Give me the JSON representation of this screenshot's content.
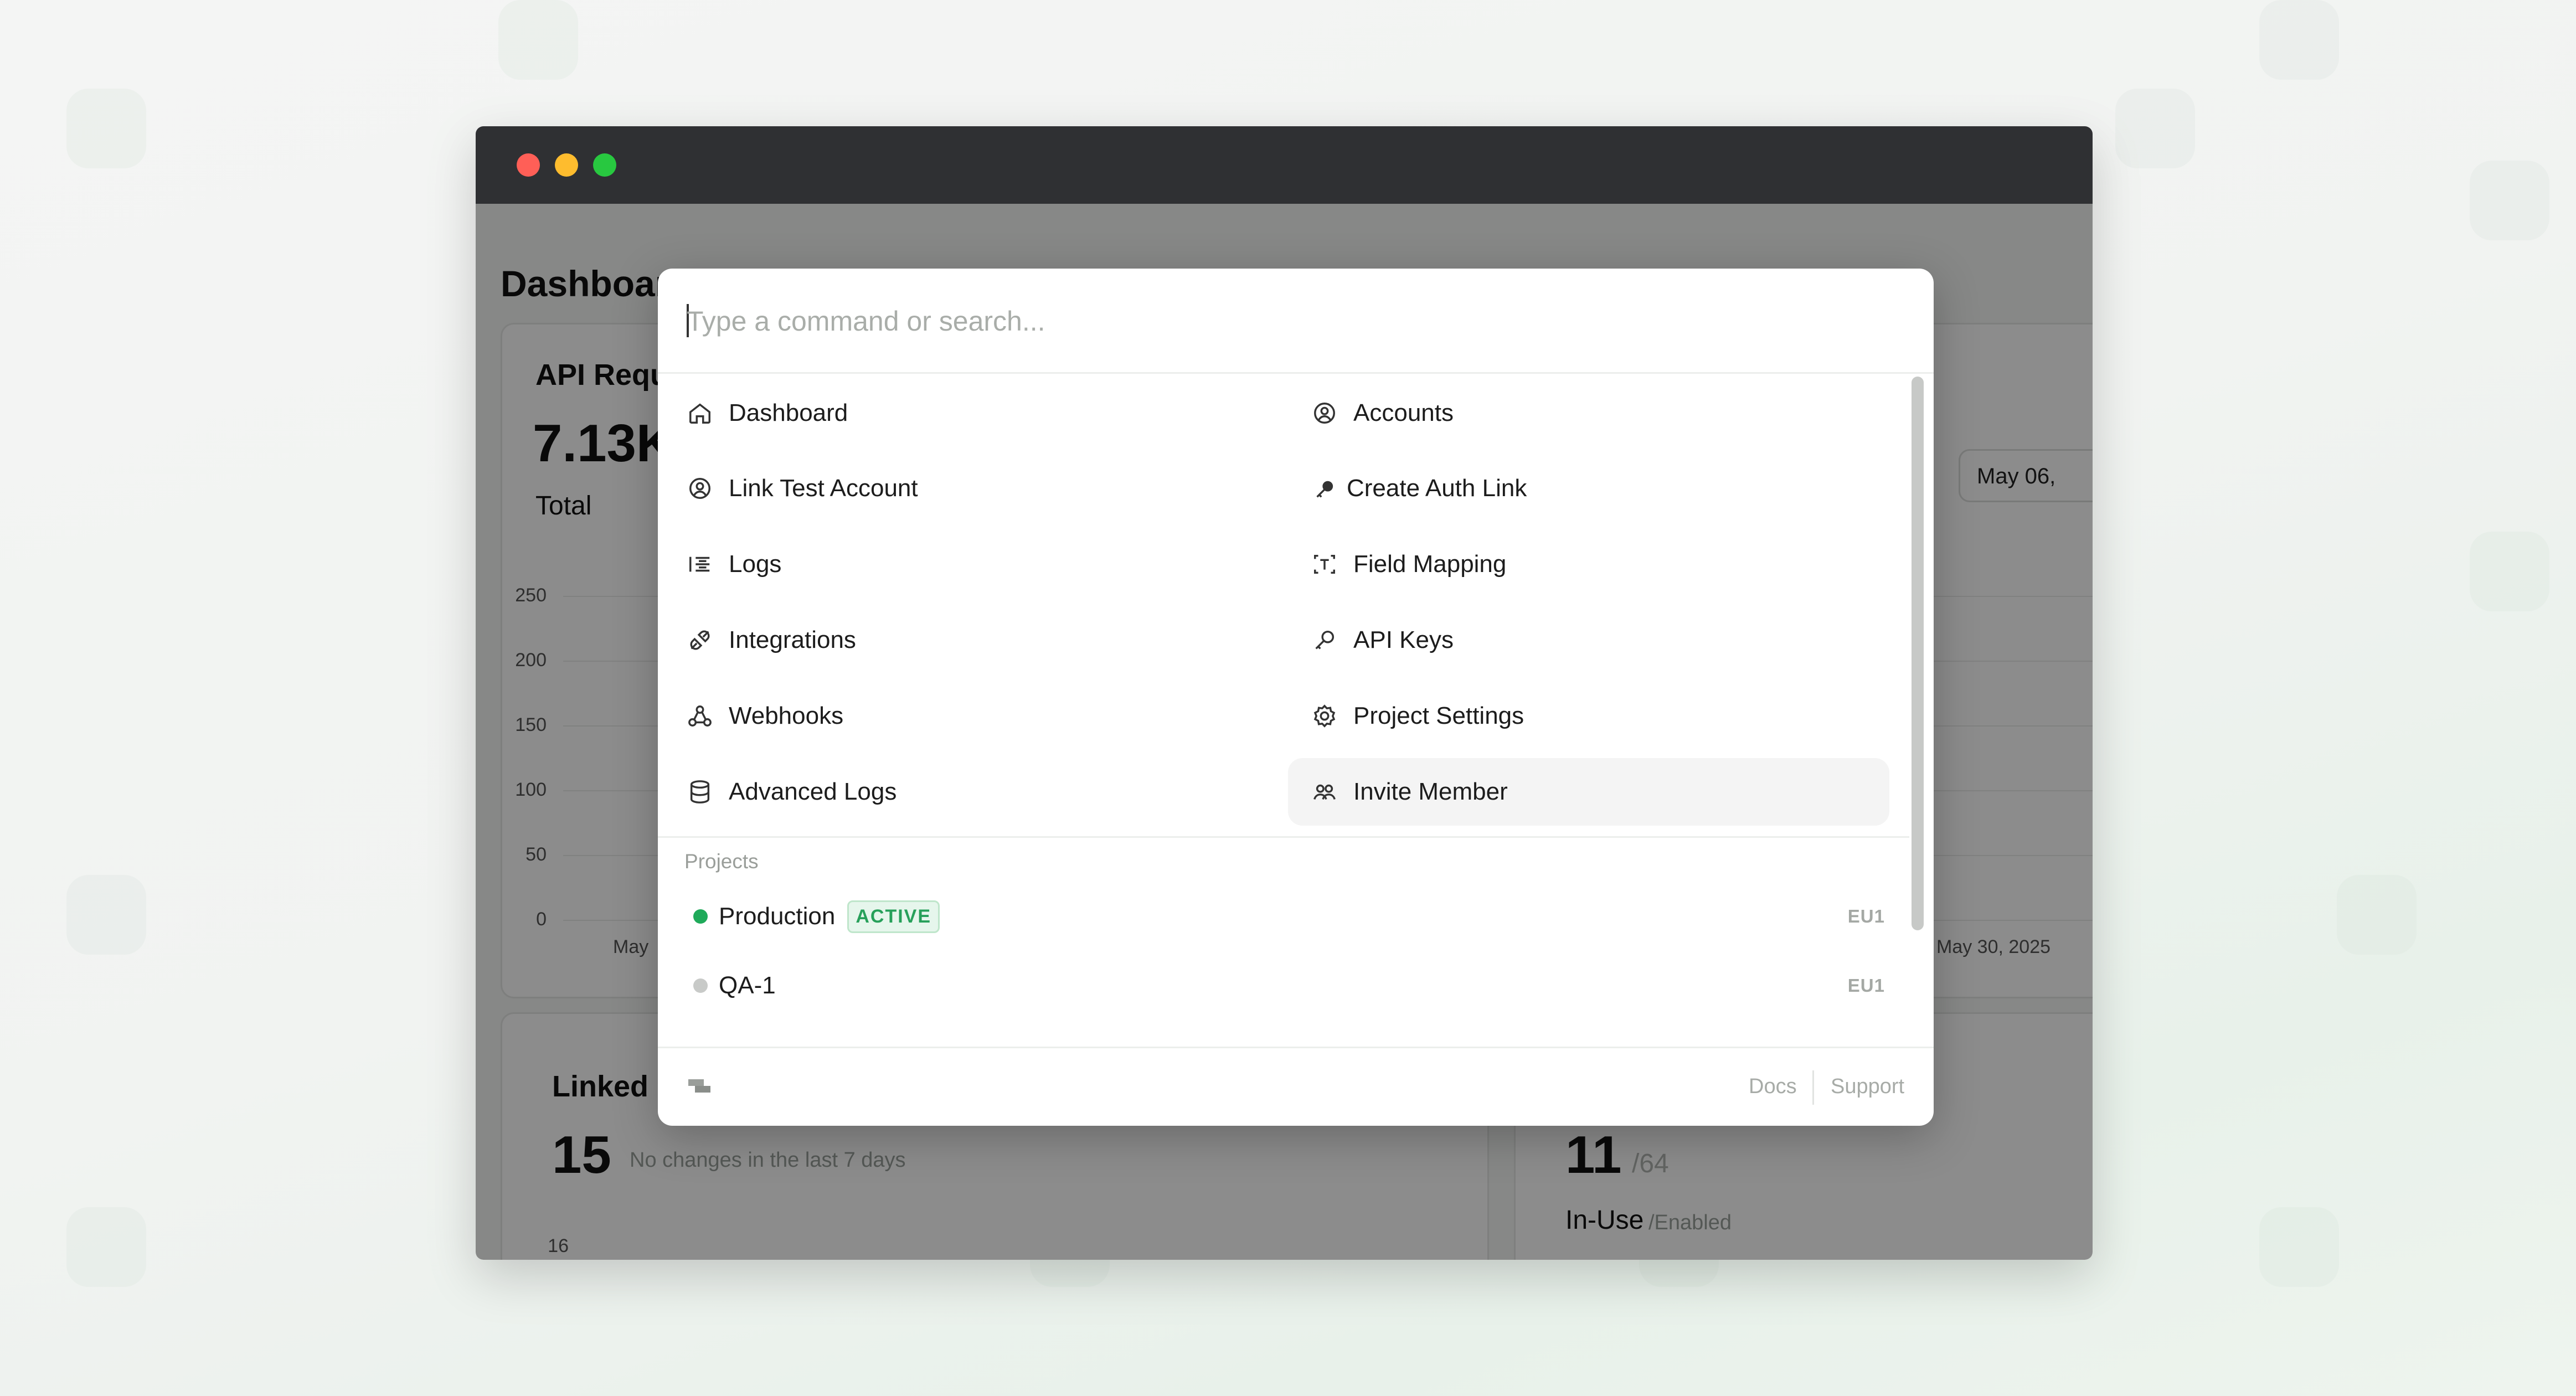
{
  "app": {
    "page_title": "Dashboard"
  },
  "dashboard": {
    "api_requests": {
      "title": "API Requests",
      "total_value": "7.13K",
      "total_label": "Total",
      "y_ticks": [
        "250",
        "200",
        "150",
        "100",
        "50",
        "0"
      ],
      "x_label_start": "May",
      "x_label_end": "May 30, 2025",
      "date_range_button": "May 06,",
      "bar_color": "#2e7d45"
    },
    "linked_accounts": {
      "title": "Linked",
      "value": "15",
      "change_text": "No changes in the last 7 days",
      "y_tick_top": "16"
    },
    "integrations_card": {
      "value": "11",
      "value_suffix": "/64",
      "label": "In-Use",
      "label_suffix": "/Enabled"
    }
  },
  "command_palette": {
    "search": {
      "placeholder": "Type a command or search...",
      "value": ""
    },
    "items": [
      {
        "label": "Dashboard",
        "icon": "home-icon"
      },
      {
        "label": "Accounts",
        "icon": "user-circle-icon"
      },
      {
        "label": "Link Test Account",
        "icon": "user-circle-icon"
      },
      {
        "label": "Create Auth Link",
        "icon": "key-icon"
      },
      {
        "label": "Logs",
        "icon": "list-icon"
      },
      {
        "label": "Field Mapping",
        "icon": "text-mapping-icon"
      },
      {
        "label": "Integrations",
        "icon": "plug-icon"
      },
      {
        "label": "API Keys",
        "icon": "key-icon"
      },
      {
        "label": "Webhooks",
        "icon": "webhook-icon"
      },
      {
        "label": "Project Settings",
        "icon": "gear-icon"
      },
      {
        "label": "Advanced Logs",
        "icon": "database-icon"
      },
      {
        "label": "Invite Member",
        "icon": "users-icon",
        "highlighted": true
      }
    ],
    "projects_section": {
      "label": "Projects",
      "projects": [
        {
          "name": "Production",
          "badge": "ACTIVE",
          "region": "EU1",
          "status_color": "#1faa5a"
        },
        {
          "name": "QA-1",
          "badge": "",
          "region": "EU1",
          "status_color": "#c8cac8"
        }
      ]
    },
    "footer": {
      "docs_label": "Docs",
      "support_label": "Support"
    }
  },
  "colors": {
    "window_chrome": "#2f3033",
    "close": "#ff5f57",
    "minimize": "#febc2e",
    "maximize": "#28c840",
    "accent_green": "#27a05a"
  }
}
